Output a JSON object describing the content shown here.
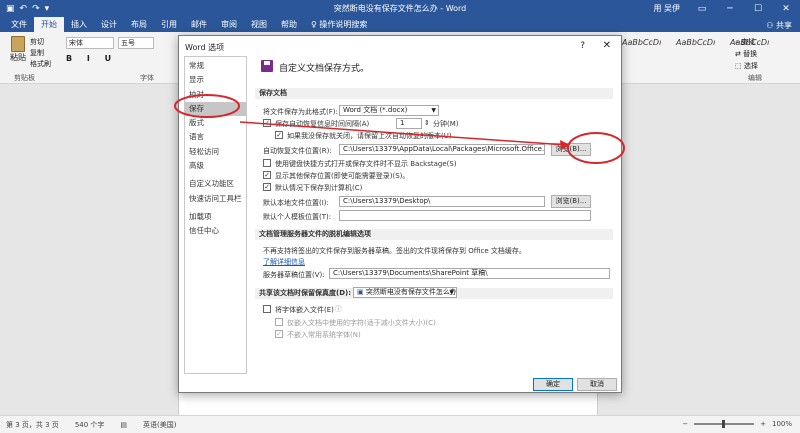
{
  "titlebar": {
    "doc_title": "突然断电没有保存文件怎么办 - Word",
    "user": "用 吴伊",
    "qat_icons": [
      "save-icon",
      "undo-icon",
      "redo-icon",
      "customize-icon"
    ]
  },
  "tabs": [
    "文件",
    "开始",
    "插入",
    "设计",
    "布局",
    "引用",
    "邮件",
    "审阅",
    "视图",
    "帮助",
    "操作说明搜索"
  ],
  "share": "共享",
  "ribbon": {
    "paste": "粘贴",
    "clipboard_items": [
      "剪切",
      "复制",
      "格式刷"
    ],
    "clipboard_label": "剪贴板",
    "font_name": "宋体",
    "font_size": "五号",
    "format_buttons": "B I U",
    "font_label": "字体",
    "styles": [
      "AaBbCcDı",
      "AaBbCcDı",
      "AaBbCcDı"
    ],
    "editing_items": [
      "查找",
      "替换",
      "选择"
    ],
    "editing_label": "编辑"
  },
  "dialog": {
    "title": "Word 选项",
    "help": "?",
    "close": "✕",
    "nav": [
      "常规",
      "显示",
      "校对",
      "保存",
      "版式",
      "语言",
      "轻松访问",
      "高级",
      "自定义功能区",
      "快速访问工具栏",
      "加载项",
      "信任中心"
    ],
    "heading": "自定义文档保存方式。",
    "sections": {
      "save_docs": "保存文档",
      "offline": "文档管理服务器文件的脱机编辑选项",
      "share": "共享该文档时保留保真度(D):"
    },
    "save_format_label": "将文件保存为此格式(F):",
    "save_format_value": "Word 文档 (*.docx)",
    "autorecover_label": "保存自动恢复信息时间间隔(A)",
    "autorecover_minutes": "1",
    "minutes_unit": "分钟(M)",
    "keep_last_label": "如果我没保存就关闭，请保留上次自动恢复的版本(U)",
    "autorecover_location_label": "自动恢复文件位置(R):",
    "autorecover_location_value": "C:\\Users\\13379\\AppData\\Local\\Packages\\Microsoft.Office.Desktop_8wekyb3",
    "browse1": "浏览(B)...",
    "no_backstage_label": "使用键盘快捷方式打开或保存文件时不显示 Backstage(S)",
    "show_locations_label": "显示其他保存位置(即使可能需要登录)(S)。",
    "save_to_computer_label": "默认情况下保存到计算机(C)",
    "default_local_label": "默认本地文件位置(I):",
    "default_local_value": "C:\\Users\\13379\\Desktop\\",
    "browse2": "浏览(B)...",
    "default_personal_label": "默认个人模板位置(T):",
    "default_personal_value": "",
    "offline_note": "不再支持将签出的文件保存到服务器草稿。签出的文件现将保存到 Office 文档缓存。",
    "offline_link": "了解详细信息",
    "server_drafts_label": "服务器草稿位置(V):",
    "server_drafts_value": "C:\\Users\\13379\\Documents\\SharePoint 草稿\\",
    "share_doc_value": "突然断电没有保存文件怎么办",
    "embed_fonts_label": "将字体嵌入文件(E)",
    "embed_only_used": "仅嵌入文档中使用的字符(适于减小文件大小)(C)",
    "no_common_fonts": "不嵌入常用系统字体(N)",
    "ok": "确定",
    "cancel": "取消"
  },
  "statusbar": {
    "page": "第 3 页，共 3 页",
    "words": "540 个字",
    "lang": "英语(美国)",
    "zoom": "100%"
  }
}
